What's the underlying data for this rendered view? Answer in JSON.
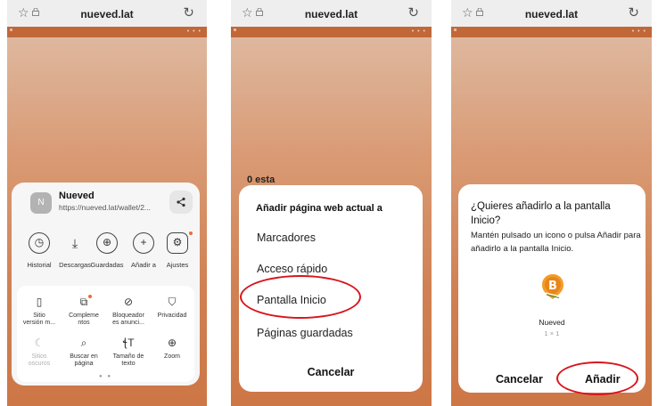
{
  "browser": {
    "domain": "nueved.lat"
  },
  "panel1": {
    "site": {
      "avatar_letter": "N",
      "name": "Nueved",
      "url": "https://nueved.lat/wallet/2..."
    },
    "quick_actions": [
      {
        "icon": "clock-icon",
        "label": "Historial"
      },
      {
        "icon": "download-icon",
        "label": "Descargas"
      },
      {
        "icon": "globe-icon",
        "label": "Guardadas"
      },
      {
        "icon": "plus-circle-icon",
        "label": "Añadir a"
      },
      {
        "icon": "gear-icon",
        "label": "Ajustes"
      }
    ],
    "grid": [
      {
        "icon": "phone-icon",
        "label_line1": "Sitio",
        "label_line2": "versión m...",
        "disabled": false
      },
      {
        "icon": "puzzle-icon",
        "label_line1": "Compleme",
        "label_line2": "ntos",
        "disabled": false
      },
      {
        "icon": "block-icon",
        "label_line1": "Bloqueador",
        "label_line2": "es anunci...",
        "disabled": false
      },
      {
        "icon": "shield-icon",
        "label_line1": "Privacidad",
        "label_line2": "",
        "disabled": false
      },
      {
        "icon": "moon-icon",
        "label_line1": "Sitios",
        "label_line2": "oscuros",
        "disabled": true
      },
      {
        "icon": "find-icon",
        "label_line1": "Buscar en",
        "label_line2": "página",
        "disabled": false
      },
      {
        "icon": "text-size-icon",
        "label_line1": "Tamaño de",
        "label_line2": "texto",
        "disabled": false
      },
      {
        "icon": "zoom-icon",
        "label_line1": "Zoom",
        "label_line2": "",
        "disabled": false
      }
    ]
  },
  "panel2": {
    "background_text": "0 esta",
    "dialog_title": "Añadir página web actual a",
    "options": [
      "Marcadores",
      "Acceso rápido",
      "Pantalla Inicio",
      "Páginas guardadas"
    ],
    "cancel": "Cancelar"
  },
  "panel3": {
    "title": "¿Quieres añadirlo a la pantalla Inicio?",
    "body": "Mantén pulsado un icono o pulsa Añadir para añadirlo a la pantalla Inicio.",
    "app_name": "Nueved",
    "app_size": "1 × 1",
    "cancel": "Cancelar",
    "add": "Añadir"
  },
  "colors": {
    "highlight_ring": "#d9141c",
    "page_accent": "#dc7f4b",
    "bitcoin_orange": "#f39c2a"
  }
}
